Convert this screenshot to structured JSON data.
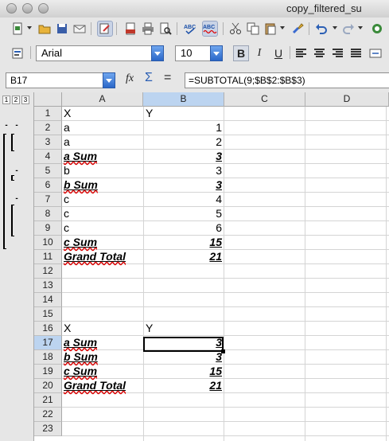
{
  "window": {
    "title": "copy_filtered_su"
  },
  "toolbar2": {
    "font_name": "Arial",
    "font_size": "10",
    "bold_label": "B",
    "italic_label": "I",
    "underline_label": "U"
  },
  "formula_bar": {
    "cell_ref": "B17",
    "formula": "=SUBTOTAL(9;$B$2:$B$3)",
    "function_wizard": "fx",
    "sum_symbol": "Σ",
    "equals_symbol": "="
  },
  "outline": {
    "levels": [
      "1",
      "2",
      "3"
    ]
  },
  "columns": [
    "A",
    "B",
    "C",
    "D"
  ],
  "rows": [
    {
      "n": "1",
      "a": "X",
      "b": "Y",
      "sum": false
    },
    {
      "n": "2",
      "a": "a",
      "b": "1",
      "sum": false
    },
    {
      "n": "3",
      "a": "a",
      "b": "2",
      "sum": false
    },
    {
      "n": "4",
      "a": "a Sum",
      "b": "3",
      "sum": true
    },
    {
      "n": "5",
      "a": "b",
      "b": "3",
      "sum": false
    },
    {
      "n": "6",
      "a": "b Sum",
      "b": "3",
      "sum": true
    },
    {
      "n": "7",
      "a": "c",
      "b": "4",
      "sum": false
    },
    {
      "n": "8",
      "a": "c",
      "b": "5",
      "sum": false
    },
    {
      "n": "9",
      "a": "c",
      "b": "6",
      "sum": false
    },
    {
      "n": "10",
      "a": "c Sum",
      "b": "15",
      "sum": true
    },
    {
      "n": "11",
      "a": "Grand Total",
      "b": "21",
      "sum": true
    },
    {
      "n": "12",
      "a": "",
      "b": "",
      "sum": false
    },
    {
      "n": "13",
      "a": "",
      "b": "",
      "sum": false
    },
    {
      "n": "14",
      "a": "",
      "b": "",
      "sum": false
    },
    {
      "n": "15",
      "a": "",
      "b": "",
      "sum": false
    },
    {
      "n": "16",
      "a": "X",
      "b": "Y",
      "sum": false
    },
    {
      "n": "17",
      "a": "a Sum",
      "b": "3",
      "sum": true
    },
    {
      "n": "18",
      "a": "b Sum",
      "b": "3",
      "sum": true
    },
    {
      "n": "19",
      "a": "c Sum",
      "b": "15",
      "sum": true
    },
    {
      "n": "20",
      "a": "Grand Total",
      "b": "21",
      "sum": true
    },
    {
      "n": "21",
      "a": "",
      "b": "",
      "sum": false
    },
    {
      "n": "22",
      "a": "",
      "b": "",
      "sum": false
    },
    {
      "n": "23",
      "a": "",
      "b": "",
      "sum": false
    }
  ],
  "selection": {
    "cell": "B17",
    "row": "17",
    "col": "B"
  },
  "colors": {
    "selection_header": "#bcd4f0",
    "spell_underline": "#dd0000"
  }
}
